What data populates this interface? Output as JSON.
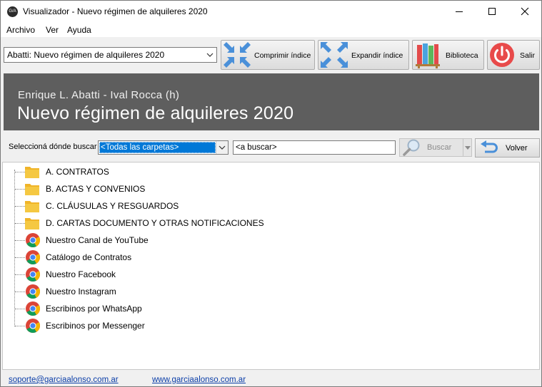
{
  "window": {
    "app_icon_text": "G/A",
    "title": "Visualizador - Nuevo régimen de alquileres 2020"
  },
  "menu": {
    "items": [
      {
        "label": "Archivo"
      },
      {
        "label": "Ver"
      },
      {
        "label": "Ayuda"
      }
    ]
  },
  "toolbar": {
    "book_select": {
      "value": "Abatti: Nuevo régimen de alquileres 2020"
    },
    "collapse_label": "Comprimir índice",
    "expand_label": "Expandir índice",
    "library_label": "Biblioteca",
    "exit_label": "Salir"
  },
  "banner": {
    "authors": "Enrique L. Abatti - Ival Rocca (h)",
    "title": "Nuevo régimen de alquileres 2020"
  },
  "search": {
    "label": "Seleccioná dónde buscar",
    "folder_value": "<Todas las carpetas>",
    "placeholder": "<a buscar>",
    "search_button": "Buscar",
    "back_button": "Volver"
  },
  "tree": {
    "items": [
      {
        "label": "A. CONTRATOS",
        "icon": "folder-icon"
      },
      {
        "label": "B. ACTAS Y CONVENIOS",
        "icon": "folder-icon"
      },
      {
        "label": "C. CLÁUSULAS Y RESGUARDOS",
        "icon": "folder-icon"
      },
      {
        "label": "D. CARTAS DOCUMENTO Y OTRAS NOTIFICACIONES",
        "icon": "folder-icon"
      },
      {
        "label": "Nuestro Canal de YouTube",
        "icon": "chrome-icon"
      },
      {
        "label": "Catálogo de Contratos",
        "icon": "chrome-icon"
      },
      {
        "label": "Nuestro Facebook",
        "icon": "chrome-icon"
      },
      {
        "label": "Nuestro Instagram",
        "icon": "chrome-icon"
      },
      {
        "label": "Escribinos por WhatsApp",
        "icon": "chrome-icon"
      },
      {
        "label": "Escribinos por Messenger",
        "icon": "chrome-icon"
      }
    ]
  },
  "footer": {
    "email_link": "soporte@garciaalonso.com.ar",
    "web_link": "www.garciaalonso.com.ar"
  },
  "colors": {
    "banner_bg": "#5e5e5e",
    "selection": "#0078d7",
    "link": "#0b3ea8",
    "folder": "#f5c842",
    "exit_red": "#e84a4a",
    "arrow_blue": "#4a90d9"
  }
}
